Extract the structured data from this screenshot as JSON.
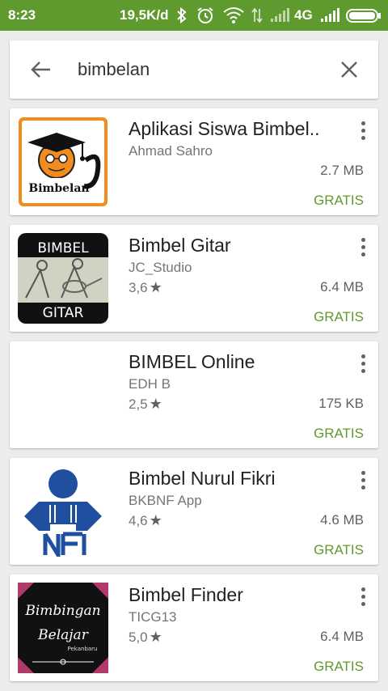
{
  "status_bar": {
    "time": "8:23",
    "speed": "19,5K/d",
    "network": "4G",
    "icons": [
      "bluetooth-icon",
      "alarm-icon",
      "wifi-icon",
      "data-transfer-icon",
      "signal-icon",
      "battery-icon"
    ]
  },
  "search": {
    "query": "bimbelan",
    "back_icon": "arrow-back-icon",
    "clear_icon": "close-icon"
  },
  "colors": {
    "status_bar": "#5f9a2e",
    "price": "#5f9a2e",
    "background": "#ececec"
  },
  "results": [
    {
      "title": "Aplikasi Siswa Bimbel..",
      "developer": "Ahmad Sahro",
      "rating": "",
      "size": "2.7 MB",
      "price": "GRATIS",
      "icon_text": "Bimbelan"
    },
    {
      "title": "Bimbel Gitar",
      "developer": "JC_Studio",
      "rating": "3,6",
      "size": "6.4 MB",
      "price": "GRATIS",
      "icon_text_top": "BIMBEL",
      "icon_text_bottom": "GITAR"
    },
    {
      "title": "BIMBEL Online",
      "developer": "EDH B",
      "rating": "2,5",
      "size": "175 KB",
      "price": "GRATIS"
    },
    {
      "title": "Bimbel Nurul Fikri",
      "developer": "BKBNF App",
      "rating": "4,6",
      "size": "4.6 MB",
      "price": "GRATIS"
    },
    {
      "title": "Bimbel Finder",
      "developer": "TICG13",
      "rating": "5,0",
      "size": "6.4 MB",
      "price": "GRATIS",
      "icon_text_top": "Bimbingan",
      "icon_text_mid": "Belajar",
      "icon_text_small": "Pekanbaru"
    }
  ]
}
